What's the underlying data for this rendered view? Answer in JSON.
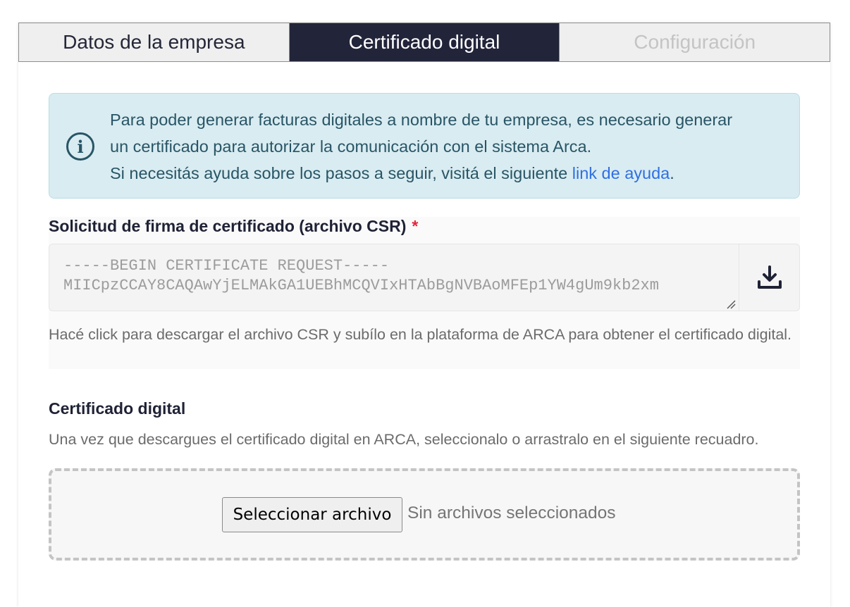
{
  "tabs": [
    {
      "label": "Datos de la empresa",
      "state": "normal"
    },
    {
      "label": "Certificado digital",
      "state": "active"
    },
    {
      "label": "Configuración",
      "state": "disabled"
    }
  ],
  "info_alert": {
    "icon": "info-icon",
    "line1": "Para poder generar facturas digitales a nombre de tu empresa, es necesario generar",
    "line2": "un certificado para autorizar la comunicación con el sistema Arca.",
    "line3_prefix": "Si necesitás ayuda sobre los pasos a seguir, visitá el siguiente ",
    "link_text": "link de ayuda",
    "line3_suffix": "."
  },
  "csr": {
    "label": "Solicitud de firma de certificado (archivo CSR)",
    "required_mark": "*",
    "value": "-----BEGIN CERTIFICATE REQUEST-----\nMIICpzCCAY8CAQAwYjELMAkGA1UEBhMCQVIxHTAbBgNVBAoMFEp1YW4gUm9kb2xm",
    "download_icon": "download-icon",
    "help_text": "Hacé click para descargar el archivo CSR y subílo en la plataforma de ARCA para obtener el certificado digital."
  },
  "certificate": {
    "title": "Certificado digital",
    "description": "Una vez que descargues el certificado digital en ARCA, seleccionalo o arrastralo en el siguiente recuadro.",
    "file_button_label": "Seleccionar archivo",
    "file_status": "Sin archivos seleccionados"
  },
  "colors": {
    "active_tab_bg": "#22243a",
    "alert_bg": "#d9ecf1",
    "alert_text": "#285566",
    "link": "#2f6fe4",
    "required": "#e4263b"
  }
}
